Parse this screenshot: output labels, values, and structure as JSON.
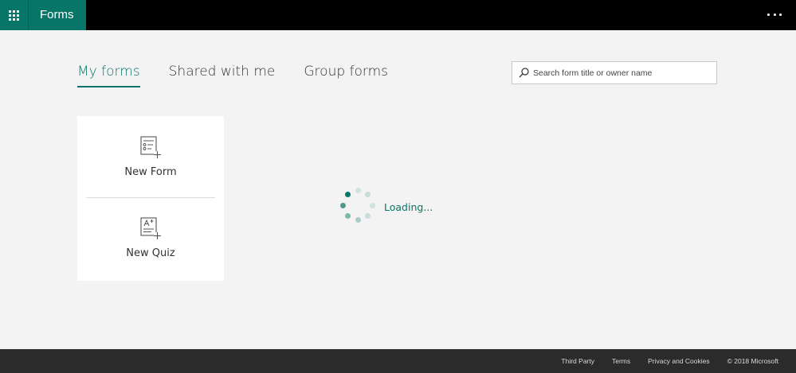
{
  "header": {
    "app_name": "Forms",
    "launcher_icon": "waffle-icon",
    "more_icon": "ellipsis-icon",
    "brand_color": "#077568"
  },
  "tabs": [
    {
      "label": "My forms",
      "active": true
    },
    {
      "label": "Shared with me",
      "active": false
    },
    {
      "label": "Group forms",
      "active": false
    }
  ],
  "search": {
    "placeholder": "Search form title or owner name",
    "icon": "search-icon"
  },
  "create": {
    "new_form_label": "New Form",
    "new_quiz_label": "New Quiz"
  },
  "status": {
    "loading_text": "Loading..."
  },
  "footer": {
    "links": [
      "Third Party",
      "Terms",
      "Privacy and Cookies"
    ],
    "copyright": "© 2018 Microsoft"
  }
}
